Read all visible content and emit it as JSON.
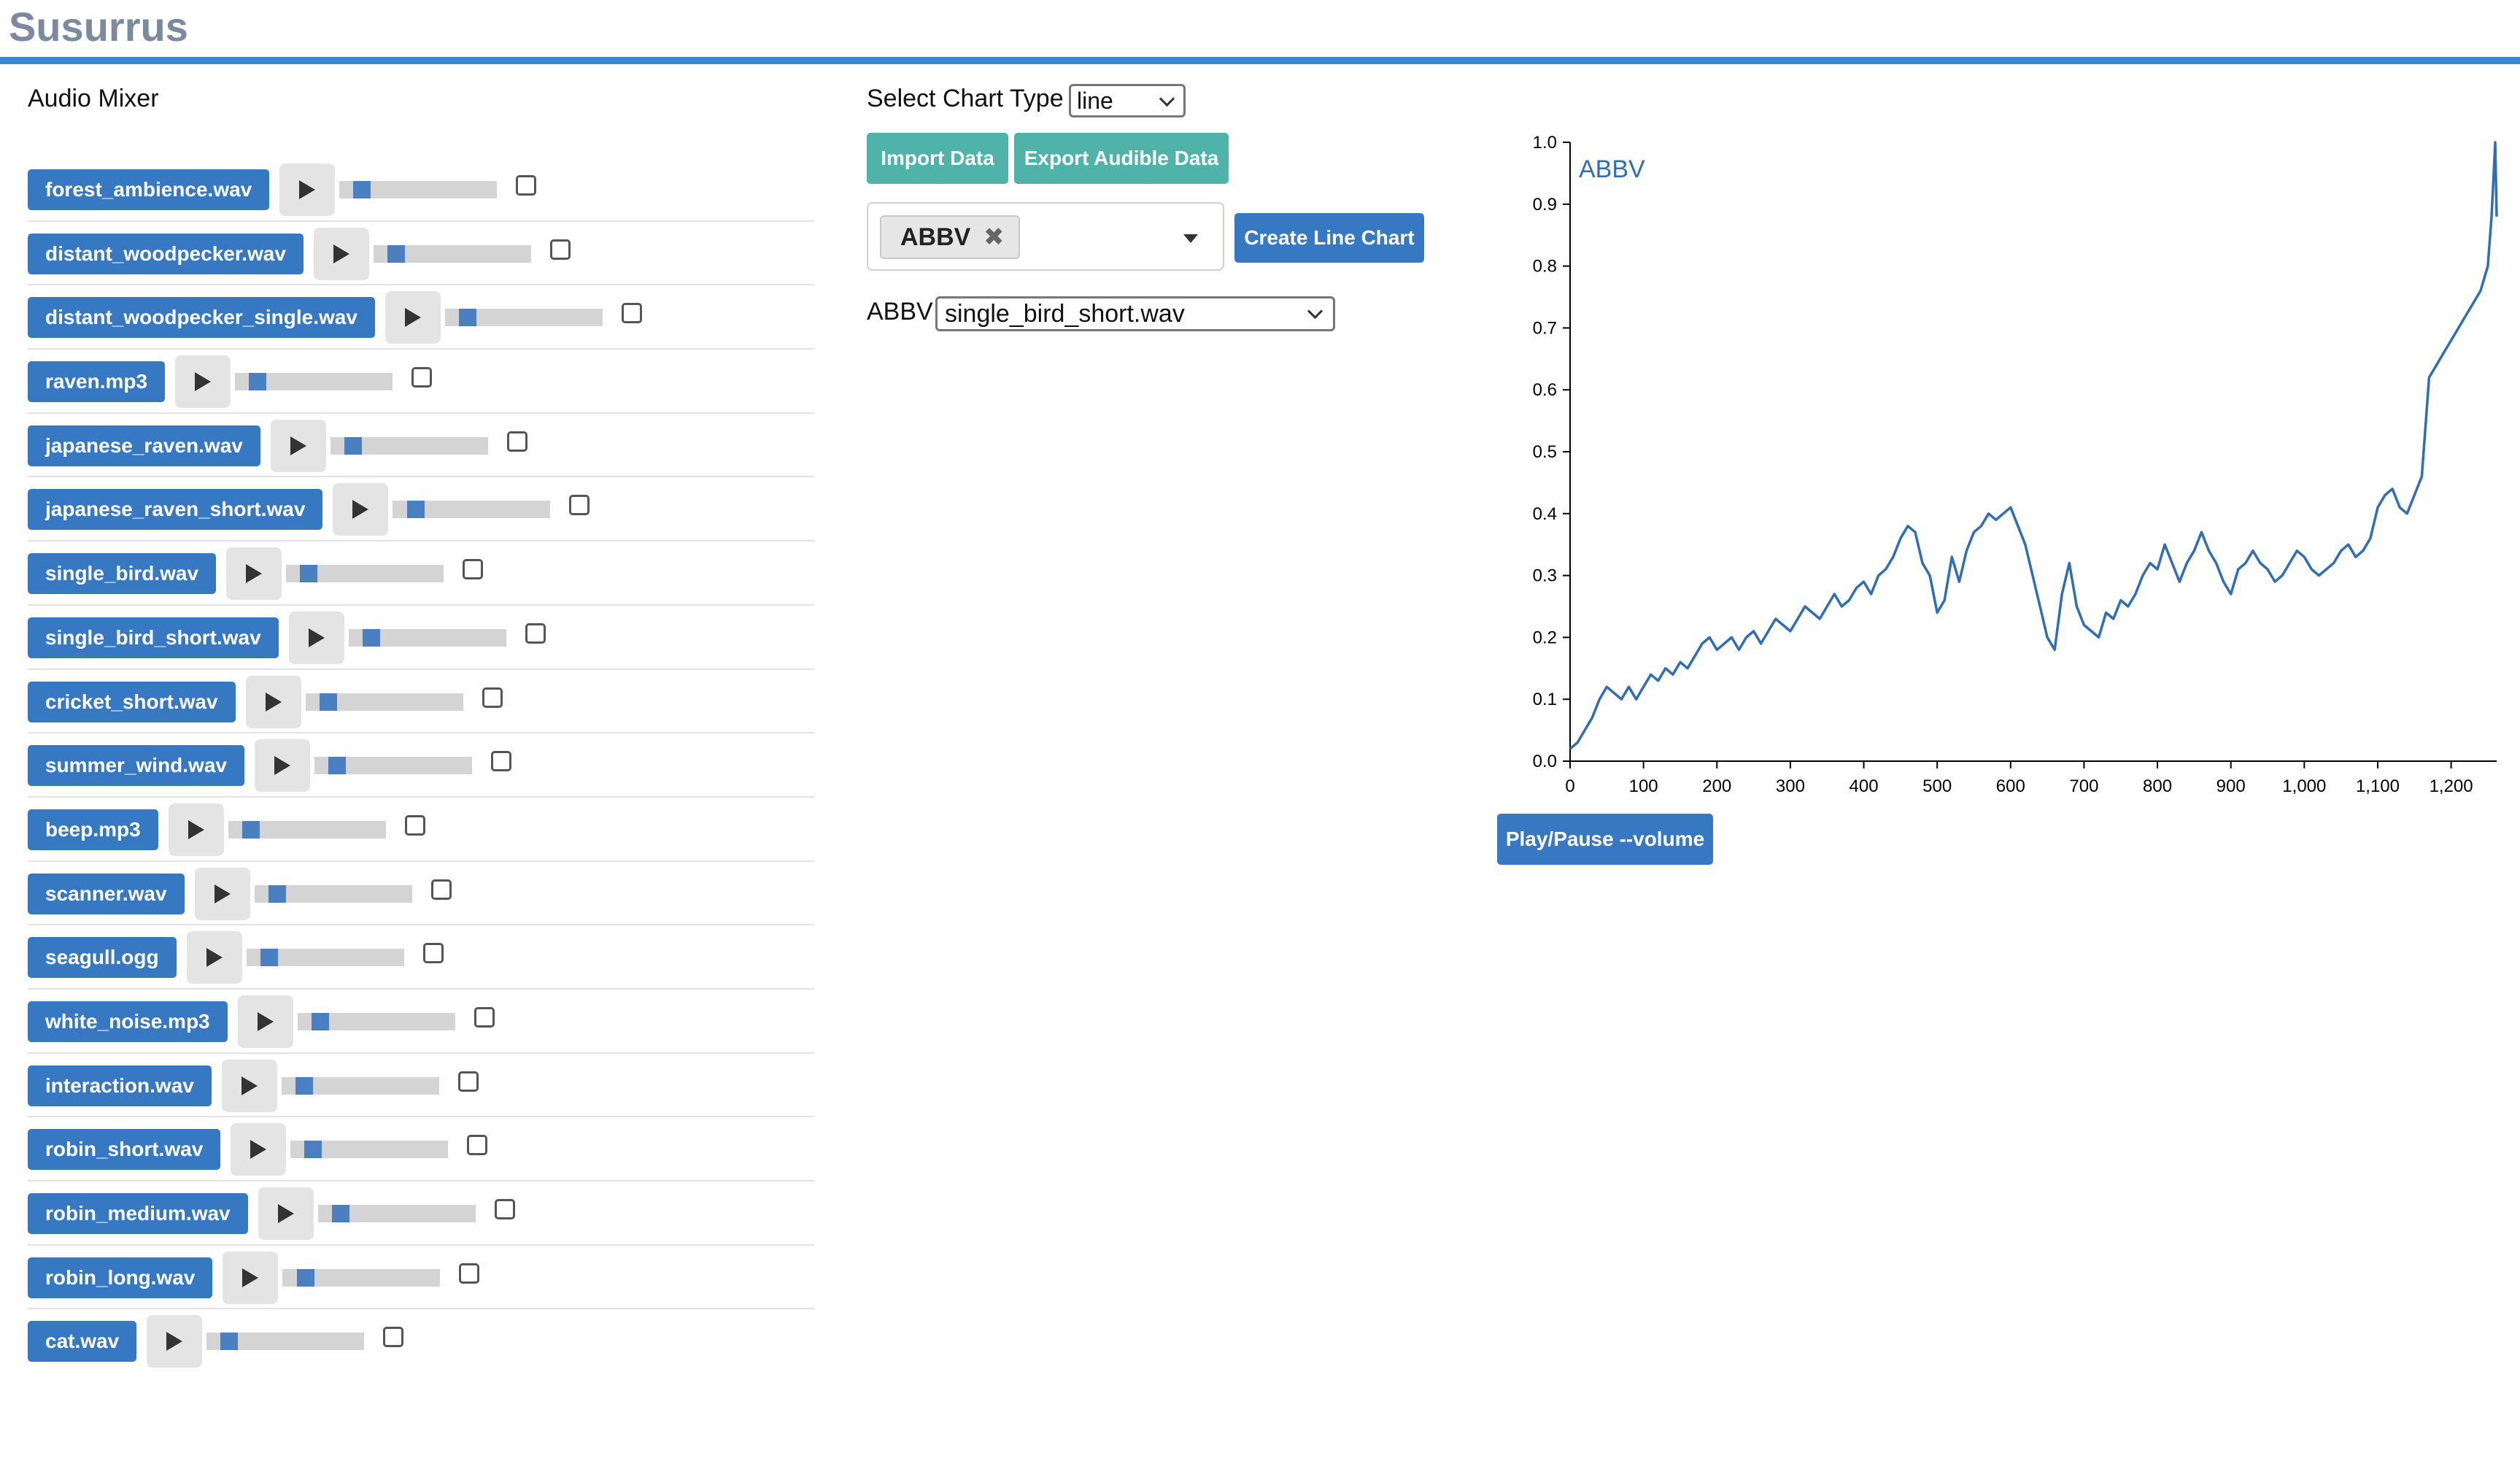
{
  "app": {
    "title": "Susurrus"
  },
  "mixer": {
    "heading": "Audio Mixer",
    "tracks": [
      {
        "file": "forest_ambience.wav",
        "volume": 0.1
      },
      {
        "file": "distant_woodpecker.wav",
        "volume": 0.1
      },
      {
        "file": "distant_woodpecker_single.wav",
        "volume": 0.1
      },
      {
        "file": "raven.mp3",
        "volume": 0.1
      },
      {
        "file": "japanese_raven.wav",
        "volume": 0.1
      },
      {
        "file": "japanese_raven_short.wav",
        "volume": 0.1
      },
      {
        "file": "single_bird.wav",
        "volume": 0.1
      },
      {
        "file": "single_bird_short.wav",
        "volume": 0.1
      },
      {
        "file": "cricket_short.wav",
        "volume": 0.1
      },
      {
        "file": "summer_wind.wav",
        "volume": 0.1
      },
      {
        "file": "beep.mp3",
        "volume": 0.1
      },
      {
        "file": "scanner.wav",
        "volume": 0.1
      },
      {
        "file": "seagull.ogg",
        "volume": 0.1
      },
      {
        "file": "white_noise.mp3",
        "volume": 0.1
      },
      {
        "file": "interaction.wav",
        "volume": 0.1
      },
      {
        "file": "robin_short.wav",
        "volume": 0.1
      },
      {
        "file": "robin_medium.wav",
        "volume": 0.1
      },
      {
        "file": "robin_long.wav",
        "volume": 0.1
      },
      {
        "file": "cat.wav",
        "volume": 0.1
      }
    ],
    "play_icon": "play-icon"
  },
  "controls": {
    "chart_type_label": "Select Chart Type",
    "chart_type_value": "line",
    "import_label": "Import Data",
    "export_label": "Export Audible Data",
    "ticker_value": "ABBV",
    "create_chart_label": "Create Line Chart",
    "assign_label": "ABBV",
    "assign_value": "single_bird_short.wav",
    "play_pause_label": "Play/Pause --volume"
  },
  "colors": {
    "accent": "#3a86d8",
    "button_blue": "#3778c2",
    "button_teal": "#4fb3a9",
    "title_gray": "#7c8aa0",
    "line": "#2f6eb3"
  },
  "chart_data": {
    "type": "line",
    "title": "",
    "series": [
      {
        "name": "ABBV",
        "x": [
          0,
          10,
          20,
          30,
          40,
          50,
          60,
          70,
          80,
          90,
          100,
          110,
          120,
          130,
          140,
          150,
          160,
          170,
          180,
          190,
          200,
          210,
          220,
          230,
          240,
          250,
          260,
          270,
          280,
          290,
          300,
          310,
          320,
          330,
          340,
          350,
          360,
          370,
          380,
          390,
          400,
          410,
          420,
          430,
          440,
          450,
          460,
          470,
          480,
          490,
          500,
          510,
          520,
          530,
          540,
          550,
          560,
          570,
          580,
          590,
          600,
          610,
          620,
          630,
          640,
          650,
          660,
          670,
          680,
          690,
          700,
          710,
          720,
          730,
          740,
          750,
          760,
          770,
          780,
          790,
          800,
          810,
          820,
          830,
          840,
          850,
          860,
          870,
          880,
          890,
          900,
          910,
          920,
          930,
          940,
          950,
          960,
          970,
          980,
          990,
          1000,
          1010,
          1020,
          1030,
          1040,
          1050,
          1060,
          1070,
          1080,
          1090,
          1100,
          1110,
          1120,
          1130,
          1140,
          1150,
          1160,
          1170,
          1180,
          1190,
          1200,
          1210,
          1220,
          1230,
          1240,
          1250,
          1255,
          1258,
          1260,
          1262
        ],
        "y": [
          0.02,
          0.03,
          0.05,
          0.07,
          0.1,
          0.12,
          0.11,
          0.1,
          0.12,
          0.1,
          0.12,
          0.14,
          0.13,
          0.15,
          0.14,
          0.16,
          0.15,
          0.17,
          0.19,
          0.2,
          0.18,
          0.19,
          0.2,
          0.18,
          0.2,
          0.21,
          0.19,
          0.21,
          0.23,
          0.22,
          0.21,
          0.23,
          0.25,
          0.24,
          0.23,
          0.25,
          0.27,
          0.25,
          0.26,
          0.28,
          0.29,
          0.27,
          0.3,
          0.31,
          0.33,
          0.36,
          0.38,
          0.37,
          0.32,
          0.3,
          0.24,
          0.26,
          0.33,
          0.29,
          0.34,
          0.37,
          0.38,
          0.4,
          0.39,
          0.4,
          0.41,
          0.38,
          0.35,
          0.3,
          0.25,
          0.2,
          0.18,
          0.27,
          0.32,
          0.25,
          0.22,
          0.21,
          0.2,
          0.24,
          0.23,
          0.26,
          0.25,
          0.27,
          0.3,
          0.32,
          0.31,
          0.35,
          0.32,
          0.29,
          0.32,
          0.34,
          0.37,
          0.34,
          0.32,
          0.29,
          0.27,
          0.31,
          0.32,
          0.34,
          0.32,
          0.31,
          0.29,
          0.3,
          0.32,
          0.34,
          0.33,
          0.31,
          0.3,
          0.31,
          0.32,
          0.34,
          0.35,
          0.33,
          0.34,
          0.36,
          0.41,
          0.43,
          0.44,
          0.41,
          0.4,
          0.43,
          0.46,
          0.62,
          0.64,
          0.66,
          0.68,
          0.7,
          0.72,
          0.74,
          0.76,
          0.8,
          0.88,
          0.95,
          1.0,
          0.88
        ]
      }
    ],
    "xlim": [
      0,
      1262
    ],
    "ylim": [
      0,
      1.0
    ],
    "xticks": [
      "0",
      "100",
      "200",
      "300",
      "400",
      "500",
      "600",
      "700",
      "800",
      "900",
      "1,000",
      "1,100",
      "1,200"
    ],
    "yticks": [
      "0.0",
      "0.1",
      "0.2",
      "0.3",
      "0.4",
      "0.5",
      "0.6",
      "0.7",
      "0.8",
      "0.9",
      "1.0"
    ],
    "legend": "top-left",
    "grid": false
  }
}
